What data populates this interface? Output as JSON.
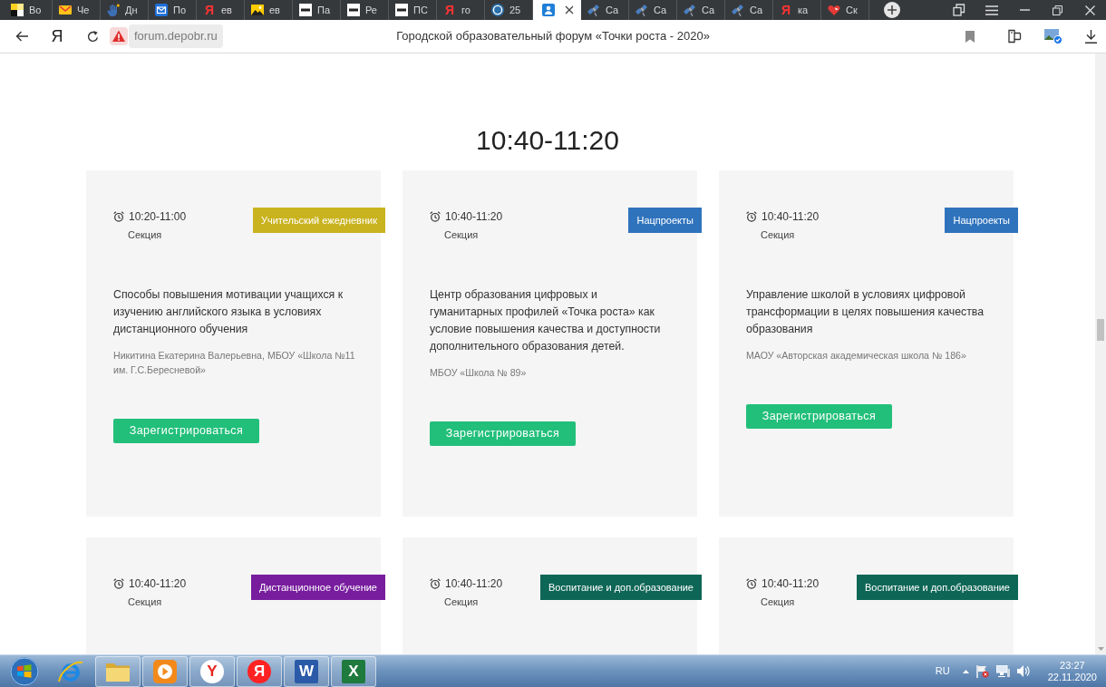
{
  "browser": {
    "tabs": [
      {
        "kind": "zen",
        "title": "Во",
        "selected": false
      },
      {
        "kind": "mail",
        "title": "Че",
        "selected": false
      },
      {
        "kind": "hand",
        "title": "Дн",
        "selected": false
      },
      {
        "kind": "envelope",
        "title": "По",
        "selected": false
      },
      {
        "kind": "yandex",
        "glyph": "Я",
        "title": "ев",
        "selected": false
      },
      {
        "kind": "picture",
        "title": "ев",
        "selected": false
      },
      {
        "kind": "wix",
        "title": "Па",
        "selected": false
      },
      {
        "kind": "wix",
        "title": "Ре",
        "selected": false
      },
      {
        "kind": "wix",
        "title": "ПС",
        "selected": false
      },
      {
        "kind": "yandex",
        "glyph": "Я",
        "title": "го",
        "selected": false
      },
      {
        "kind": "wordpress",
        "title": "25",
        "selected": false
      },
      {
        "kind": "profile",
        "selected": true
      },
      {
        "kind": "satellite",
        "title": "Са",
        "selected": false
      },
      {
        "kind": "satellite",
        "title": "Са",
        "selected": false
      },
      {
        "kind": "satellite",
        "title": "Са",
        "selected": false
      },
      {
        "kind": "satellite",
        "title": "Са",
        "selected": false
      },
      {
        "kind": "yandex",
        "glyph": "Я",
        "title": "ка",
        "selected": false
      },
      {
        "kind": "heart",
        "title": "Ск",
        "selected": false
      }
    ],
    "address": {
      "logo": "Я",
      "url": "forum.depobr.ru",
      "page_title": "Городской образовательный форум «Точки роста - 2020»"
    }
  },
  "page": {
    "heading": "10:40-11:20",
    "cards": [
      {
        "time": "10:20-11:00",
        "type": "Секция",
        "tag": {
          "label": "Учительский ежедневник",
          "color": "#c9b31f"
        },
        "title": "Способы повышения мотивации учащихся к изучению английского языка в условиях дистанционного обучения",
        "author": "Никитина Екатерина Валерьевна, МБОУ «Школа №11 им. Г.С.Бересневой»",
        "button": "Зарегистрироваться"
      },
      {
        "time": "10:40-11:20",
        "type": "Секция",
        "tag": {
          "label": "Нацпроекты",
          "color": "#2f73bd"
        },
        "title": "Центр образования цифровых и гуманитарных профилей «Точка роста» как условие повышения качества и доступности дополнительного образования детей.",
        "author": "МБОУ «Школа № 89»",
        "button": "Зарегистрироваться"
      },
      {
        "time": "10:40-11:20",
        "type": "Секция",
        "tag": {
          "label": "Нацпроекты",
          "color": "#2f73bd"
        },
        "title": "Управление школой в условиях цифровой трансформации в целях повышения качества образования",
        "author": "МАОУ «Авторская академическая школа № 186»",
        "button": "Зарегистрироваться"
      },
      {
        "time": "10:40-11:20",
        "type": "Секция",
        "tag": {
          "label": "Дистанционное обучение",
          "color": "#781d9e"
        }
      },
      {
        "time": "10:40-11:20",
        "type": "Секция",
        "tag": {
          "label": "Воспитание и доп.образование",
          "color": "#0e6656"
        }
      },
      {
        "time": "10:40-11:20",
        "type": "Секция",
        "tag": {
          "label": "Воспитание и доп.образование",
          "color": "#0e6656"
        }
      }
    ]
  },
  "taskbar": {
    "apps": [
      {
        "kind": "ie",
        "running": false
      },
      {
        "kind": "folder",
        "running": true
      },
      {
        "kind": "media",
        "running": true
      },
      {
        "kind": "yandex-browser",
        "glyph": "Y",
        "running": true
      },
      {
        "kind": "yandex",
        "glyph": "Я",
        "running": true
      },
      {
        "kind": "word",
        "glyph": "W",
        "running": true
      },
      {
        "kind": "excel",
        "glyph": "X",
        "running": true
      }
    ],
    "language": "RU",
    "time": "23:27",
    "date": "22.11.2020"
  }
}
